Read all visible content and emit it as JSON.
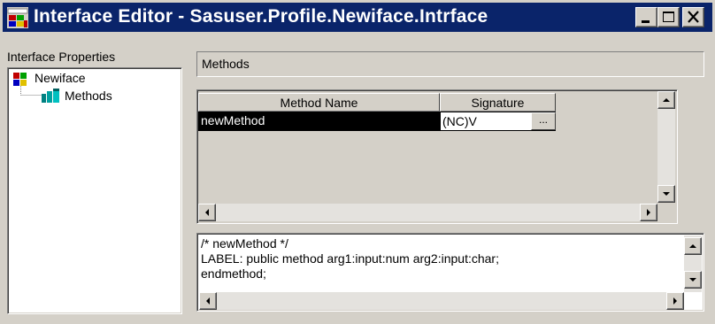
{
  "window": {
    "title": "Interface Editor - Sasuser.Profile.Newiface.Intrface",
    "controls": {
      "minimize": "minimize-icon",
      "maximize": "maximize-icon",
      "close": "close-icon"
    }
  },
  "tree": {
    "label": "Interface Properties",
    "root": {
      "label": "Newiface",
      "icon": "interface-icon"
    },
    "children": [
      {
        "label": "Methods",
        "icon": "methods-icon"
      }
    ]
  },
  "methods_field": {
    "value": "Methods"
  },
  "grid": {
    "columns": [
      "Method Name",
      "Signature"
    ],
    "rows": [
      {
        "method_name": "newMethod",
        "signature": "(NC)V",
        "button_label": "..."
      }
    ]
  },
  "code": {
    "lines": [
      "/* newMethod */",
      "LABEL: public method  arg1:input:num arg2:input:char;",
      "endmethod;"
    ]
  },
  "colors": {
    "titlebar": "#0a246a",
    "face": "#d4d0c8",
    "selection": "#000000"
  }
}
